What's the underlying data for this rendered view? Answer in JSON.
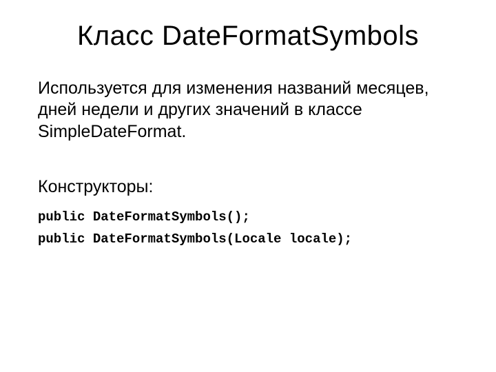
{
  "slide": {
    "title": "Класс DateFormatSymbols",
    "description": "Используется для изменения названий месяцев, дней недели и других значений в классе SimpleDateFormat.",
    "subheading": "Конструкторы:",
    "code_lines": [
      "public DateFormatSymbols();",
      "public DateFormatSymbols(Locale locale);"
    ]
  }
}
